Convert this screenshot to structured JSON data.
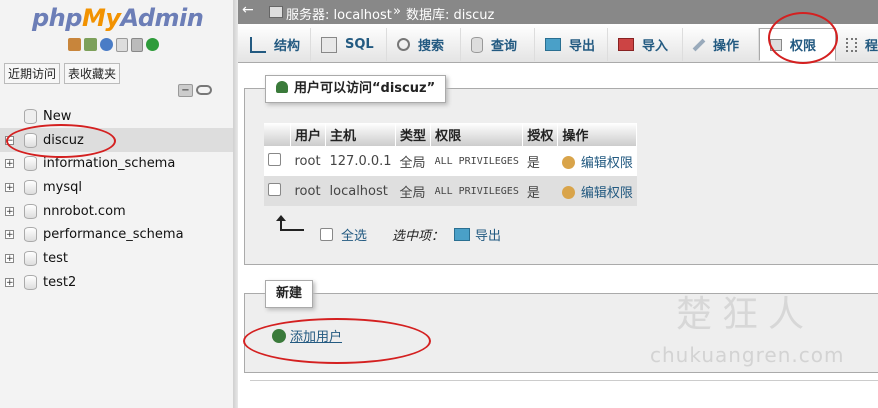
{
  "logo": {
    "php": "php",
    "my": "My",
    "admin": "Admin"
  },
  "left_nav": {
    "recent": "近期访问",
    "favorites": "表收藏夹"
  },
  "tree": [
    {
      "label": "New",
      "type": "new"
    },
    {
      "label": "discuz",
      "type": "db",
      "selected": true
    },
    {
      "label": "information_schema",
      "type": "db"
    },
    {
      "label": "mysql",
      "type": "db"
    },
    {
      "label": "nnrobot.com",
      "type": "db"
    },
    {
      "label": "performance_schema",
      "type": "db"
    },
    {
      "label": "test",
      "type": "db"
    },
    {
      "label": "test2",
      "type": "db"
    }
  ],
  "breadcrumb": {
    "server": "服务器: localhost",
    "sep": "»",
    "database": "数据库: discuz"
  },
  "tabs": [
    {
      "label": "结构",
      "icon": "structure-icon"
    },
    {
      "label": "SQL",
      "icon": "sql-icon"
    },
    {
      "label": "搜索",
      "icon": "search-icon"
    },
    {
      "label": "查询",
      "icon": "query-icon"
    },
    {
      "label": "导出",
      "icon": "export-icon"
    },
    {
      "label": "导入",
      "icon": "import-icon"
    },
    {
      "label": "操作",
      "icon": "wrench-icon"
    },
    {
      "label": "权限",
      "icon": "privileges-icon",
      "active": true
    },
    {
      "label": "程",
      "icon": "routines-icon"
    }
  ],
  "users_section": {
    "title": "用户可以访问“discuz”",
    "headers": [
      "用户",
      "主机",
      "类型",
      "权限",
      "授权",
      "操作"
    ],
    "rows": [
      {
        "user": "root",
        "host": "127.0.0.1",
        "type": "全局",
        "privileges": "ALL PRIVILEGES",
        "grant": "是",
        "action": "编辑权限"
      },
      {
        "user": "root",
        "host": "localhost",
        "type": "全局",
        "privileges": "ALL PRIVILEGES",
        "grant": "是",
        "action": "编辑权限"
      }
    ],
    "select_all": "全选",
    "with_selected": "选中项：",
    "export": "导出"
  },
  "new_section": {
    "title": "新建",
    "add_user": "添加用户"
  },
  "watermark": {
    "title": "楚狂人",
    "url": "chukuangren.com"
  },
  "colors": {
    "annotation_red": "#d42020",
    "link_blue": "#235a81",
    "logo_blue": "#6c7eb7",
    "logo_orange": "#f29200"
  }
}
